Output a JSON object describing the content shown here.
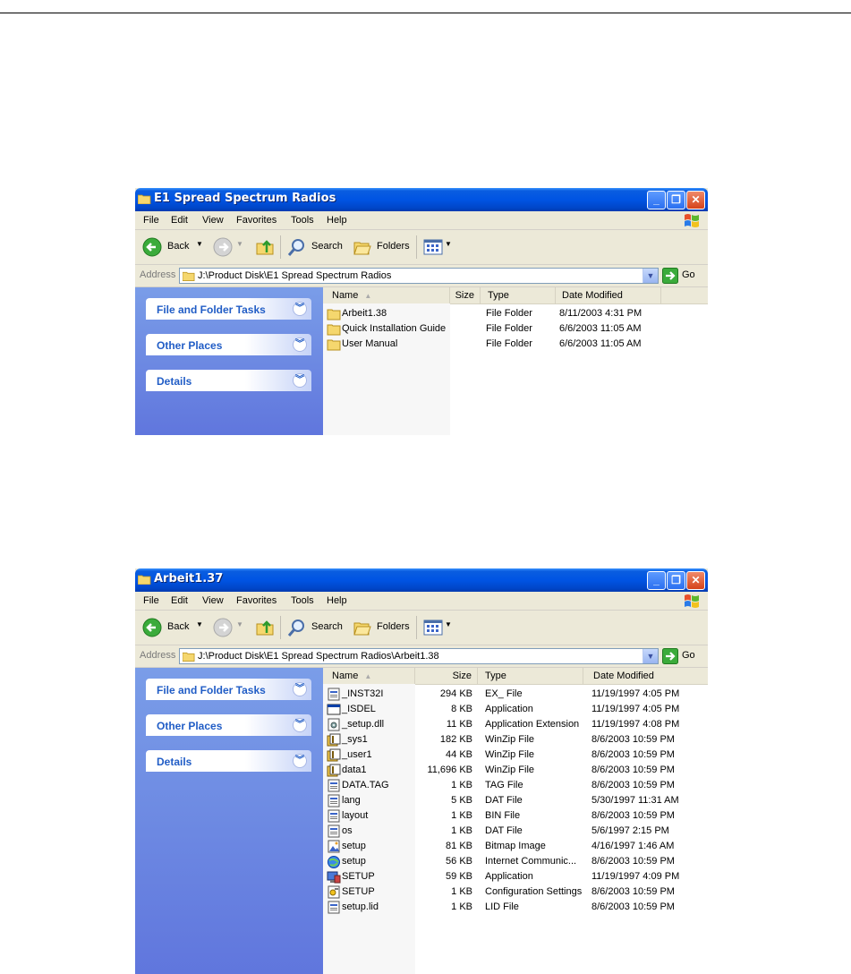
{
  "windows": [
    {
      "title": "E1 Spread Spectrum Radios",
      "menu": [
        "File",
        "Edit",
        "View",
        "Favorites",
        "Tools",
        "Help"
      ],
      "toolbar": {
        "back": "Back",
        "search": "Search",
        "folders": "Folders"
      },
      "address": {
        "label": "Address",
        "value": "J:\\Product Disk\\E1 Spread Spectrum Radios",
        "go": "Go"
      },
      "tasks": [
        "File and Folder Tasks",
        "Other Places",
        "Details"
      ],
      "columns": [
        "Name",
        "Size",
        "Type",
        "Date Modified"
      ],
      "files": [
        {
          "name": "Arbeit1.38",
          "size": "",
          "type": "File Folder",
          "date": "8/11/2003 4:31 PM",
          "icon": "folder-icon"
        },
        {
          "name": "Quick Installation Guide",
          "size": "",
          "type": "File Folder",
          "date": "6/6/2003 11:05 AM",
          "icon": "folder-icon"
        },
        {
          "name": "User Manual",
          "size": "",
          "type": "File Folder",
          "date": "6/6/2003 11:05 AM",
          "icon": "folder-icon"
        }
      ]
    },
    {
      "title": "Arbeit1.37",
      "menu": [
        "File",
        "Edit",
        "View",
        "Favorites",
        "Tools",
        "Help"
      ],
      "toolbar": {
        "back": "Back",
        "search": "Search",
        "folders": "Folders"
      },
      "address": {
        "label": "Address",
        "value": "J:\\Product Disk\\E1 Spread Spectrum Radios\\Arbeit1.38",
        "go": "Go"
      },
      "tasks": [
        "File and Folder Tasks",
        "Other Places",
        "Details"
      ],
      "columns": [
        "Name",
        "Size",
        "Type",
        "Date Modified"
      ],
      "files": [
        {
          "name": "_INST32I",
          "size": "294 KB",
          "type": "EX_ File",
          "date": "11/19/1997 4:05 PM",
          "icon": "generic-file-icon"
        },
        {
          "name": "_ISDEL",
          "size": "8 KB",
          "type": "Application",
          "date": "11/19/1997 4:05 PM",
          "icon": "application-icon"
        },
        {
          "name": "_setup.dll",
          "size": "11 KB",
          "type": "Application Extension",
          "date": "11/19/1997 4:08 PM",
          "icon": "dll-icon"
        },
        {
          "name": "_sys1",
          "size": "182 KB",
          "type": "WinZip File",
          "date": "8/6/2003 10:59 PM",
          "icon": "winzip-icon"
        },
        {
          "name": "_user1",
          "size": "44 KB",
          "type": "WinZip File",
          "date": "8/6/2003 10:59 PM",
          "icon": "winzip-icon"
        },
        {
          "name": "data1",
          "size": "11,696 KB",
          "type": "WinZip File",
          "date": "8/6/2003 10:59 PM",
          "icon": "winzip-icon"
        },
        {
          "name": "DATA.TAG",
          "size": "1 KB",
          "type": "TAG File",
          "date": "8/6/2003 10:59 PM",
          "icon": "generic-file-icon"
        },
        {
          "name": "lang",
          "size": "5 KB",
          "type": "DAT File",
          "date": "5/30/1997 11:31 AM",
          "icon": "generic-file-icon"
        },
        {
          "name": "layout",
          "size": "1 KB",
          "type": "BIN File",
          "date": "8/6/2003 10:59 PM",
          "icon": "generic-file-icon"
        },
        {
          "name": "os",
          "size": "1 KB",
          "type": "DAT File",
          "date": "5/6/1997 2:15 PM",
          "icon": "generic-file-icon"
        },
        {
          "name": "setup",
          "size": "81 KB",
          "type": "Bitmap Image",
          "date": "4/16/1997 1:46 AM",
          "icon": "bitmap-icon"
        },
        {
          "name": "setup",
          "size": "56 KB",
          "type": "Internet Communic...",
          "date": "8/6/2003 10:59 PM",
          "icon": "internet-icon"
        },
        {
          "name": "SETUP",
          "size": "59 KB",
          "type": "Application",
          "date": "11/19/1997 4:09 PM",
          "icon": "setup-app-icon"
        },
        {
          "name": "SETUP",
          "size": "1 KB",
          "type": "Configuration Settings",
          "date": "8/6/2003 10:59 PM",
          "icon": "config-icon"
        },
        {
          "name": "setup.lid",
          "size": "1 KB",
          "type": "LID File",
          "date": "8/6/2003 10:59 PM",
          "icon": "generic-file-icon"
        }
      ]
    }
  ],
  "colors": {
    "titlebar": "#0054e3",
    "sidepanel": "#6d8ee6",
    "task_title": "#215dc6",
    "toolbar": "#ece9d8"
  }
}
